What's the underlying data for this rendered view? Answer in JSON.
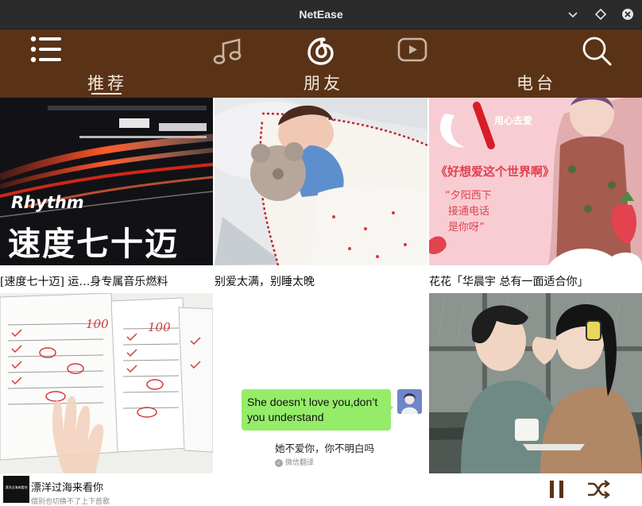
{
  "window": {
    "title": "NetEase"
  },
  "nav": {
    "tabs": [
      {
        "label": "推荐"
      },
      {
        "label": "朋友"
      },
      {
        "label": "电台"
      }
    ]
  },
  "playlists": [
    {
      "caption": "[速度七十迈] 运…身专属音乐燃料",
      "cover_title": "Rhythm",
      "cover_subtitle": "速度七十迈"
    },
    {
      "caption": "别爱太满，别睡太晚"
    },
    {
      "caption": "花花「华晨宇 总有一面适合你」",
      "cover_tag": "用心去爱",
      "cover_title": "《好想爱这个世界啊》",
      "cover_lines": [
        "“夕阳西下",
        "接通电话",
        "是你呀”"
      ]
    },
    {
      "caption": "",
      "cover_scores": [
        "100",
        "100"
      ]
    },
    {
      "caption": "",
      "chat_bubble": "She doesn’t love you,don’t you understand",
      "translation": "她不爱你，你不明白吗",
      "translation_note": "微信翻译"
    },
    {
      "caption": ""
    }
  ],
  "player": {
    "song_title": "漂洋过海来看你",
    "song_subtitle": "偿别也切换不了上下首歌",
    "thumb_text": "漂洋过海来看你"
  },
  "colors": {
    "nav_bg": "#5a3317",
    "titlebar_bg": "#2b2b2b",
    "nav_text": "#f3e8dc",
    "chat_green": "#95ec69"
  }
}
